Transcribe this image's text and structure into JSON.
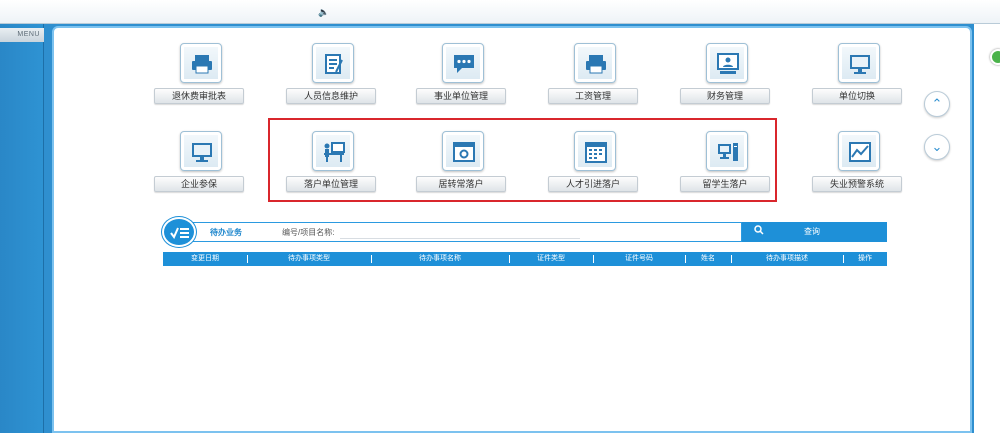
{
  "topbar": {
    "speaker_glyph": "🔈"
  },
  "sidebar": {
    "menu_label": "MENU"
  },
  "tiles_row1": [
    {
      "label": "退休费审批表",
      "icon": "printer-icon"
    },
    {
      "label": "人员信息维护",
      "icon": "document-edit-icon"
    },
    {
      "label": "事业单位管理",
      "icon": "chat-bubble-icon"
    },
    {
      "label": "工资管理",
      "icon": "printer-icon"
    },
    {
      "label": "财务管理",
      "icon": "presentation-icon"
    },
    {
      "label": "单位切换",
      "icon": "monitor-icon"
    }
  ],
  "tiles_row2": [
    {
      "label": "企业参保",
      "icon": "monitor-icon"
    },
    {
      "label": "落户单位管理",
      "icon": "desk-person-icon"
    },
    {
      "label": "居转常落户",
      "icon": "browser-window-icon"
    },
    {
      "label": "人才引进落户",
      "icon": "calendar-icon"
    },
    {
      "label": "留学生落户",
      "icon": "computer-icon"
    },
    {
      "label": "失业预警系统",
      "icon": "line-chart-icon"
    }
  ],
  "scroll": {
    "up_glyph": "⌃",
    "down_glyph": "⌄"
  },
  "todo": {
    "title": "待办业务",
    "search_label": "编号/项目名称:",
    "search_value": "",
    "query_label": "查询",
    "columns": [
      "变更日期",
      "待办事项类型",
      "待办事项名称",
      "证件类型",
      "证件号码",
      "姓名",
      "待办事项描述",
      "操作"
    ]
  }
}
